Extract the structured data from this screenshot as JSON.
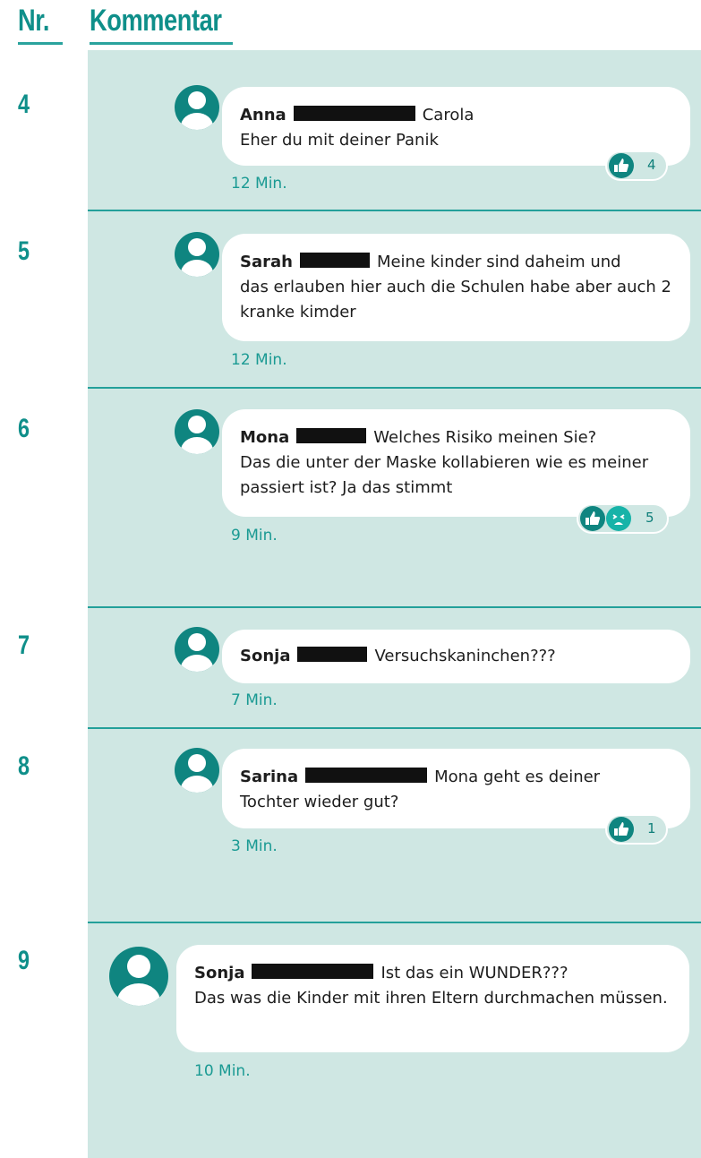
{
  "header": {
    "nr_label": "Nr.",
    "comment_label": "Kommentar"
  },
  "comments": [
    {
      "nr": "4",
      "author": "Anna",
      "text_first": "Carola",
      "text_rest": "Eher du mit deiner Panik",
      "time": "12 Min.",
      "reactions": {
        "icons": [
          "like-icon"
        ],
        "count": "4"
      }
    },
    {
      "nr": "5",
      "author": "Sarah",
      "text_first": "Meine kinder sind daheim und",
      "text_rest": "das erlauben hier auch die Schulen habe aber auch 2 kranke kimder",
      "time": "12 Min."
    },
    {
      "nr": "6",
      "author": "Mona",
      "text_first": "Welches Risiko meinen Sie?",
      "text_rest": "Das die unter der Maske kollabieren wie es meiner passiert ist? Ja das stimmt",
      "time": "9 Min.",
      "reactions": {
        "icons": [
          "like-icon",
          "sad-icon"
        ],
        "count": "5"
      }
    },
    {
      "nr": "7",
      "author": "Sonja",
      "text_first": "Versuchskaninchen???",
      "text_rest": "",
      "time": "7 Min."
    },
    {
      "nr": "8",
      "author": "Sarina",
      "text_first": "Mona geht es deiner",
      "text_rest": "Tochter wieder gut?",
      "time": "3 Min.",
      "reactions": {
        "icons": [
          "like-icon"
        ],
        "count": "1"
      }
    },
    {
      "nr": "9",
      "author": "Sonja",
      "text_first": "Ist das ein WUNDER???",
      "text_rest": "Das was die Kinder mit ihren Eltern durchmachen müssen.",
      "time": "10 Min."
    }
  ],
  "colors": {
    "accent": "#0f8f8a",
    "panel": "#cfe7e3",
    "separator": "#23a09a",
    "avatar": "#0f8580"
  }
}
